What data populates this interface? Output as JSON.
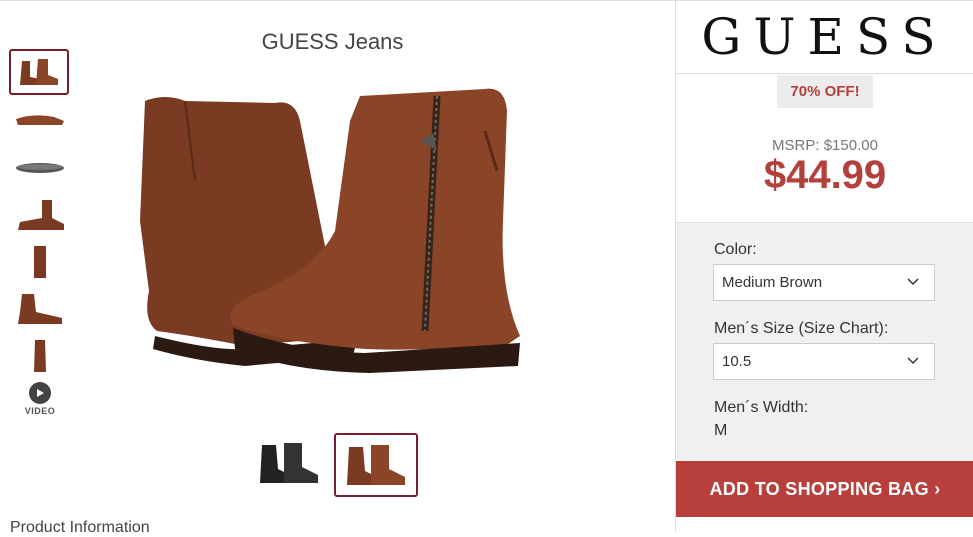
{
  "product": {
    "brand_title": "GUESS Jeans",
    "product_info_heading": "Product Information"
  },
  "thumbnails": [
    {
      "name": "thumb-brown-pair",
      "selected": true
    },
    {
      "name": "thumb-side-top"
    },
    {
      "name": "thumb-sole"
    },
    {
      "name": "thumb-side-profile"
    },
    {
      "name": "thumb-front"
    },
    {
      "name": "thumb-inner-side"
    },
    {
      "name": "thumb-back"
    }
  ],
  "video": {
    "label": "VIDEO",
    "icon": "play-icon"
  },
  "colorways": [
    {
      "name": "colorway-black",
      "color": "#2a2a2a",
      "selected": false
    },
    {
      "name": "colorway-brown",
      "color": "#7a3b22",
      "selected": true
    }
  ],
  "sidebar": {
    "logo": "GUESS",
    "badge": "70% OFF!",
    "msrp": "MSRP: $150.00",
    "price": "$44.99",
    "color_label": "Color:",
    "color_value": "Medium Brown",
    "size_label": "Men´s Size (Size Chart):",
    "size_value": "10.5",
    "width_label": "Men´s Width:",
    "width_value": "M",
    "add_button": "ADD TO SHOPPING BAG ›"
  },
  "colors": {
    "accent": "#b8403c",
    "selected_border": "#7c1d2c",
    "leather": "#7a3b22"
  }
}
